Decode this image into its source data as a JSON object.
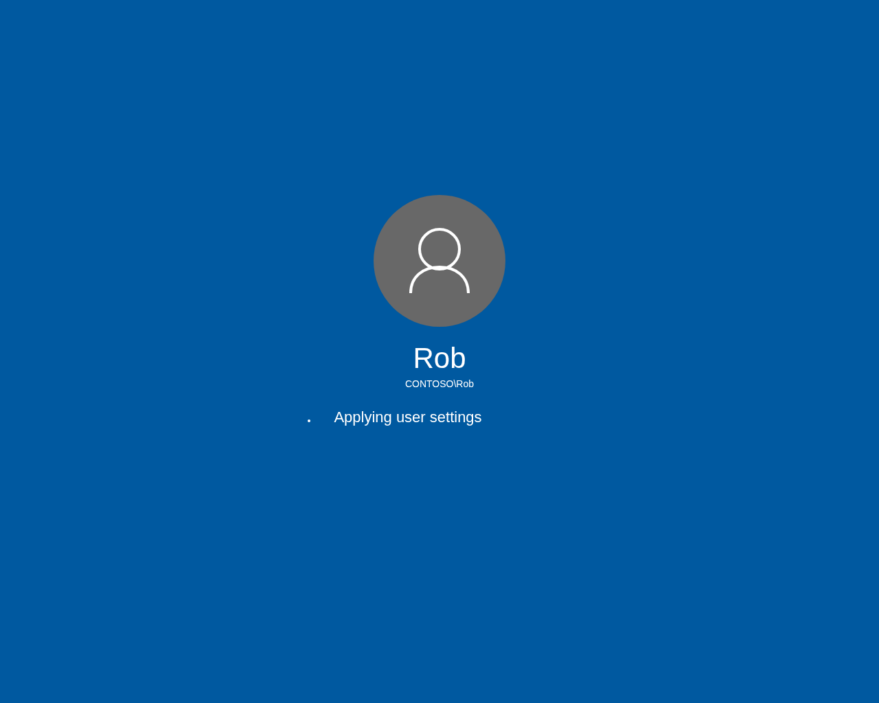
{
  "user": {
    "name": "Rob",
    "account": "CONTOSO\\Rob"
  },
  "status": {
    "message": "Applying user settings"
  }
}
